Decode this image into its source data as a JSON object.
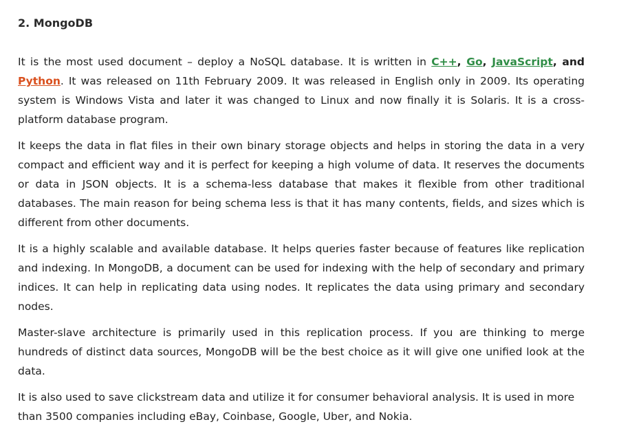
{
  "article": {
    "heading": "2. MongoDB",
    "p1": {
      "before": "It is the most used document – deploy a NoSQL database. It is written in ",
      "link_cpp": "C++",
      "sep1": ", ",
      "link_go": "Go",
      "sep2": ", ",
      "link_js": "JavaScript",
      "sep3": ", and ",
      "link_python": "Python",
      "after": ". It was released on 11th February 2009. It was released in English only in 2009. Its operating system is Windows Vista and later it was changed to Linux and now finally it is Solaris. It is a cross-platform database program."
    },
    "p2": "It keeps the data in flat files in their own binary storage objects and helps in storing the data in a very compact and efficient way and it is perfect for keeping a high volume of data. It reserves the documents or data in JSON objects. It is a schema-less database that makes it flexible from other traditional databases. The main reason for being schema less is that it has many contents, fields, and sizes which is different from other documents.",
    "p3": "It is a highly scalable and available database. It helps queries faster because of features like replication and indexing. In MongoDB, a document can be used for indexing with the help of secondary and primary indices. It can help in replicating data using nodes. It replicates the data using primary and secondary nodes.",
    "p4": "Master-slave architecture is primarily used in this replication process. If you are thinking to merge hundreds of distinct data sources, MongoDB will be the best choice as it will give one unified look at the data.",
    "p5": "It is also used to save clickstream data and utilize it for consumer behavioral analysis. It is used in more than 3500 companies including eBay, Coinbase, Google, Uber, and Nokia."
  },
  "colors": {
    "link_green": "#2f8d46",
    "link_orange": "#d9501e",
    "text": "#222222"
  }
}
